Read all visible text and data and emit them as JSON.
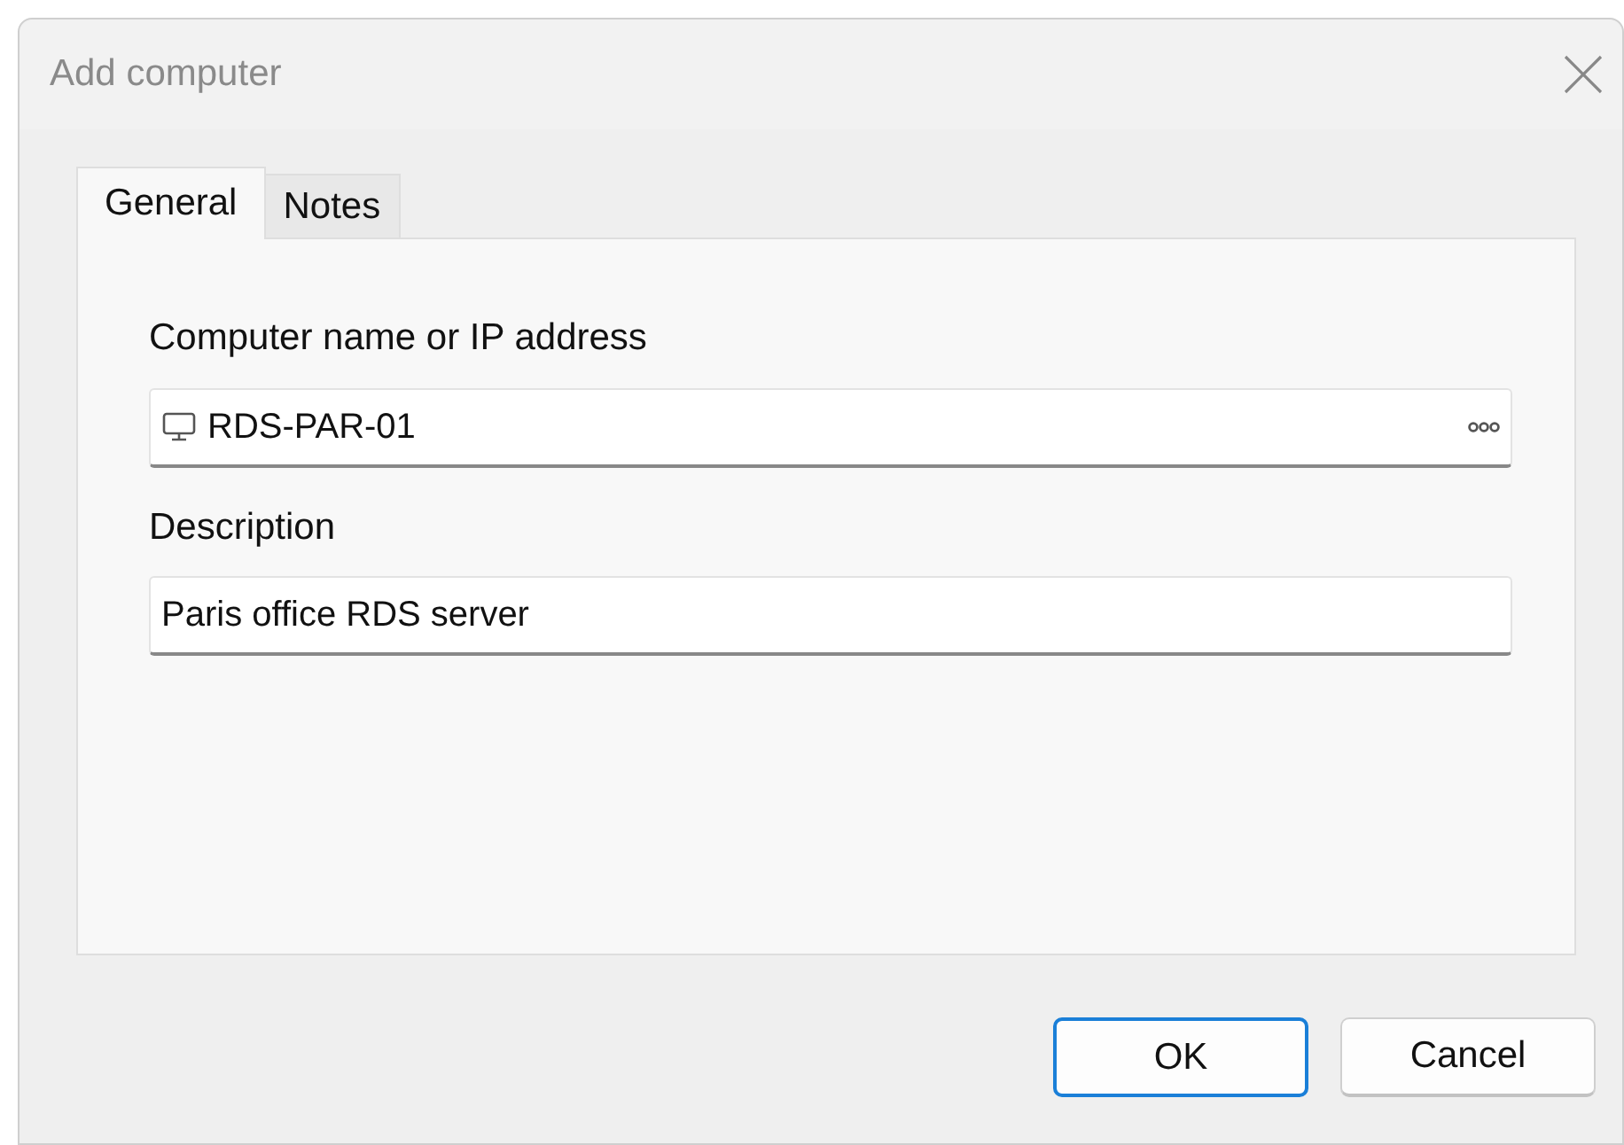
{
  "window": {
    "title": "Add computer"
  },
  "tabs": [
    {
      "label": "General",
      "selected": true
    },
    {
      "label": "Notes",
      "selected": false
    }
  ],
  "fields": [
    {
      "label": "Computer name or IP address",
      "value": "RDS-PAR-01",
      "kind": "computer"
    },
    {
      "label": "Description",
      "value": "Paris office RDS server",
      "kind": "text"
    }
  ],
  "buttons": [
    {
      "label": "OK",
      "default": true
    },
    {
      "label": "Cancel",
      "default": false
    }
  ]
}
